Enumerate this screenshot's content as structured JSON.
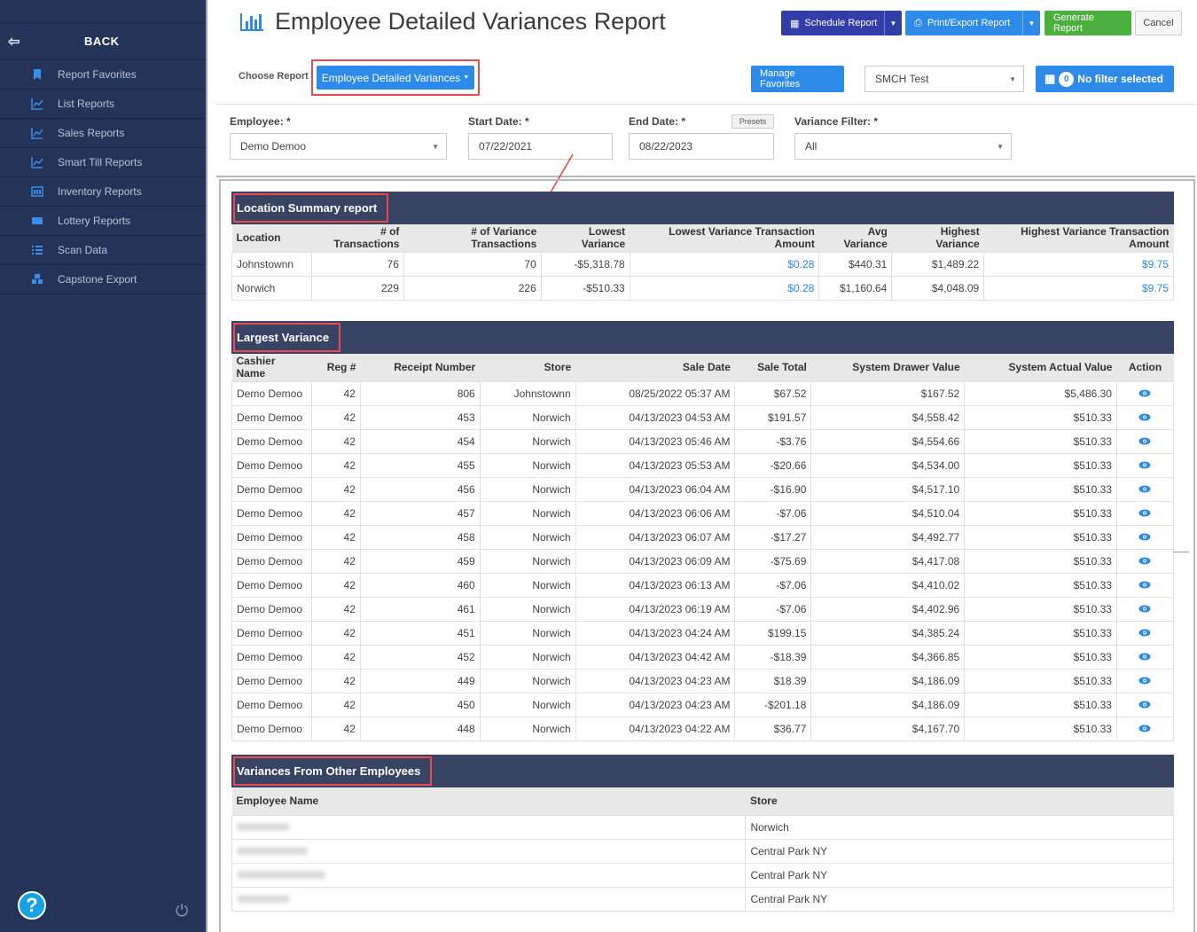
{
  "sidebar": {
    "back_label": "BACK",
    "items": [
      {
        "label": "Report Favorites",
        "icon": "bookmark-icon"
      },
      {
        "label": "List Reports",
        "icon": "line-chart-icon"
      },
      {
        "label": "Sales Reports",
        "icon": "line-chart-icon"
      },
      {
        "label": "Smart Till Reports",
        "icon": "line-chart-icon"
      },
      {
        "label": "Inventory Reports",
        "icon": "inventory-icon"
      },
      {
        "label": "Lottery Reports",
        "icon": "ticket-icon"
      },
      {
        "label": "Scan Data",
        "icon": "list-icon"
      },
      {
        "label": "Capstone Export",
        "icon": "cubes-icon"
      }
    ],
    "help_label": "?"
  },
  "header": {
    "title": "Employee Detailed Variances Report",
    "schedule_label": "Schedule Report",
    "print_label": "Print/Export Report",
    "generate_label": "Generate Report",
    "cancel_label": "Cancel",
    "choose_label": "Choose Report",
    "choose_value": "Employee Detailed Variances",
    "manage_label": "Manage Favorites",
    "store_select": "SMCH Test",
    "filter_count": "0",
    "filter_label": "No filter selected"
  },
  "filters": {
    "employee_label": "Employee: *",
    "employee_value": "Demo Demoo",
    "start_label": "Start Date: *",
    "start_value": "07/22/2021",
    "end_label": "End Date: *",
    "end_value": "08/22/2023",
    "presets_label": "Presets",
    "variance_label": "Variance Filter: *",
    "variance_value": "All"
  },
  "location_summary": {
    "title": "Location Summary report",
    "columns": [
      "Location",
      "# of Transactions",
      "# of Variance Transactions",
      "Lowest Variance",
      "Lowest Variance Transaction Amount",
      "Avg Variance",
      "Highest Variance",
      "Highest Variance Transaction Amount"
    ],
    "rows": [
      [
        "Johnstownn",
        "76",
        "70",
        "-$5,318.78",
        "$0.28",
        "$440.31",
        "$1,489.22",
        "$9.75"
      ],
      [
        "Norwich",
        "229",
        "226",
        "-$510.33",
        "$0.28",
        "$1,160.64",
        "$4,048.09",
        "$9.75"
      ]
    ]
  },
  "largest_variance": {
    "title": "Largest Variance",
    "columns": [
      "Cashier Name",
      "Reg #",
      "Receipt Number",
      "Store",
      "Sale Date",
      "Sale Total",
      "System Drawer Value",
      "System Actual Value",
      "Action"
    ],
    "rows": [
      [
        "Demo Demoo",
        "42",
        "806",
        "Johnstownn",
        "08/25/2022 05:37 AM",
        "$67.52",
        "$167.52",
        "$5,486.30"
      ],
      [
        "Demo Demoo",
        "42",
        "453",
        "Norwich",
        "04/13/2023 04:53 AM",
        "$191.57",
        "$4,558.42",
        "$510.33"
      ],
      [
        "Demo Demoo",
        "42",
        "454",
        "Norwich",
        "04/13/2023 05:46 AM",
        "-$3.76",
        "$4,554.66",
        "$510.33"
      ],
      [
        "Demo Demoo",
        "42",
        "455",
        "Norwich",
        "04/13/2023 05:53 AM",
        "-$20.66",
        "$4,534.00",
        "$510.33"
      ],
      [
        "Demo Demoo",
        "42",
        "456",
        "Norwich",
        "04/13/2023 06:04 AM",
        "-$16.90",
        "$4,517.10",
        "$510.33"
      ],
      [
        "Demo Demoo",
        "42",
        "457",
        "Norwich",
        "04/13/2023 06:06 AM",
        "-$7.06",
        "$4,510.04",
        "$510.33"
      ],
      [
        "Demo Demoo",
        "42",
        "458",
        "Norwich",
        "04/13/2023 06:07 AM",
        "-$17.27",
        "$4,492.77",
        "$510.33"
      ],
      [
        "Demo Demoo",
        "42",
        "459",
        "Norwich",
        "04/13/2023 06:09 AM",
        "-$75.69",
        "$4,417.08",
        "$510.33"
      ],
      [
        "Demo Demoo",
        "42",
        "460",
        "Norwich",
        "04/13/2023 06:13 AM",
        "-$7.06",
        "$4,410.02",
        "$510.33"
      ],
      [
        "Demo Demoo",
        "42",
        "461",
        "Norwich",
        "04/13/2023 06:19 AM",
        "-$7.06",
        "$4,402.96",
        "$510.33"
      ],
      [
        "Demo Demoo",
        "42",
        "451",
        "Norwich",
        "04/13/2023 04:24 AM",
        "$199.15",
        "$4,385.24",
        "$510.33"
      ],
      [
        "Demo Demoo",
        "42",
        "452",
        "Norwich",
        "04/13/2023 04:42 AM",
        "-$18.39",
        "$4,366.85",
        "$510.33"
      ],
      [
        "Demo Demoo",
        "42",
        "449",
        "Norwich",
        "04/13/2023 04:23 AM",
        "$18.39",
        "$4,186.09",
        "$510.33"
      ],
      [
        "Demo Demoo",
        "42",
        "450",
        "Norwich",
        "04/13/2023 04:23 AM",
        "-$201.18",
        "$4,186.09",
        "$510.33"
      ],
      [
        "Demo Demoo",
        "42",
        "448",
        "Norwich",
        "04/13/2023 04:22 AM",
        "$36.77",
        "$4,167.70",
        "$510.33"
      ]
    ]
  },
  "other_employees": {
    "title": "Variances From Other Employees",
    "columns": [
      "Employee Name",
      "Store"
    ],
    "rows": [
      [
        "",
        "Norwich"
      ],
      [
        "",
        "Central Park NY"
      ],
      [
        "",
        "Central Park NY"
      ],
      [
        "",
        "Central Park NY"
      ]
    ]
  },
  "colors": {
    "sidebar_bg": "#243458",
    "accent_blue": "#2d8ae8",
    "section_header": "#394465",
    "highlight_red": "#e84a4f",
    "generate_green": "#4caf3f",
    "schedule_navy": "#313ea8"
  }
}
